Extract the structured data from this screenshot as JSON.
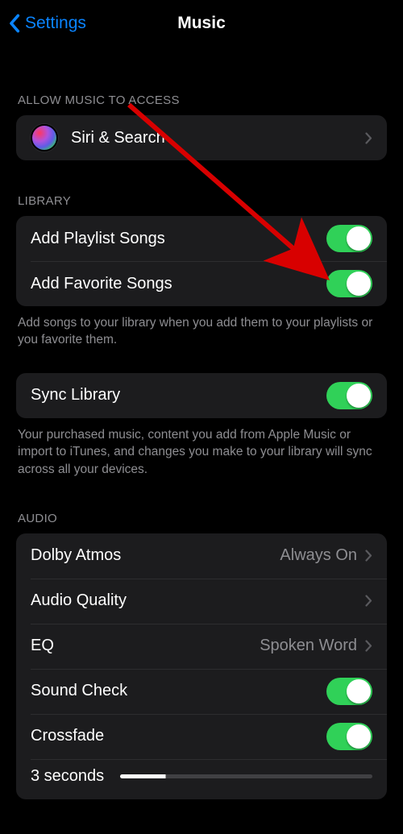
{
  "nav": {
    "back_label": "Settings",
    "title": "Music"
  },
  "sections": {
    "access": {
      "header": "ALLOW MUSIC TO ACCESS",
      "siri": "Siri & Search"
    },
    "library": {
      "header": "LIBRARY",
      "add_playlist": "Add Playlist Songs",
      "add_favorite": "Add Favorite Songs",
      "footer": "Add songs to your library when you add them to your playlists or you favorite them.",
      "sync": "Sync Library",
      "sync_footer": "Your purchased music, content you add from Apple Music or import to iTunes, and changes you make to your library will sync across all your devices."
    },
    "audio": {
      "header": "AUDIO",
      "dolby": "Dolby Atmos",
      "dolby_value": "Always On",
      "quality": "Audio Quality",
      "eq": "EQ",
      "eq_value": "Spoken Word",
      "sound_check": "Sound Check",
      "crossfade": "Crossfade",
      "crossfade_value": "3 seconds"
    }
  },
  "toggles": {
    "add_playlist": true,
    "add_favorite": true,
    "sync": true,
    "sound_check": true,
    "crossfade": true
  }
}
